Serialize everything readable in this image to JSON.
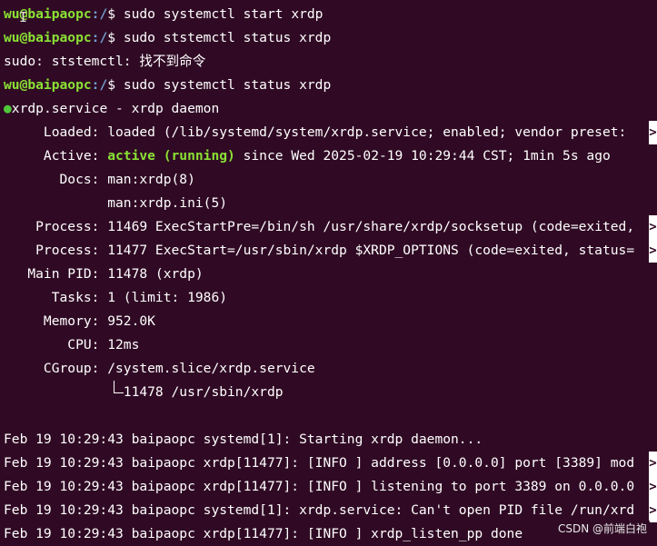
{
  "prompt": {
    "user": "wu@baipaopc",
    "path": ":/",
    "sym": "$ "
  },
  "lines": {
    "l1": "sudo systemctl start xrdp",
    "l2": "sudo ststemctl status xrdp",
    "l3": "sudo: ststemctl: 找不到命令",
    "l4": "sudo systemctl status xrdp",
    "l5": "xrdp.service - xrdp daemon",
    "l6": "     Loaded: loaded (/lib/systemd/system/xrdp.service; enabled; vendor preset: ",
    "l7a": "     Active: ",
    "l7b": "active (running)",
    "l7c": " since Wed 2025-02-19 10:29:44 CST; 1min 5s ago",
    "l8": "       Docs: man:xrdp(8)",
    "l9": "             man:xrdp.ini(5)",
    "l10": "    Process: 11469 ExecStartPre=/bin/sh /usr/share/xrdp/socksetup (code=exited,",
    "l11": "    Process: 11477 ExecStart=/usr/sbin/xrdp $XRDP_OPTIONS (code=exited, status=",
    "l12": "   Main PID: 11478 (xrdp)",
    "l13": "      Tasks: 1 (limit: 1986)",
    "l14": "     Memory: 952.0K",
    "l15": "        CPU: 12ms",
    "l16": "     CGroup: /system.slice/xrdp.service",
    "l17": "               11478 /usr/sbin/xrdp",
    "l18": "Feb 19 10:29:43 baipaopc systemd[1]: Starting xrdp daemon...",
    "l19": "Feb 19 10:29:43 baipaopc xrdp[11477]: [INFO ] address [0.0.0.0] port [3389] mod",
    "l20": "Feb 19 10:29:43 baipaopc xrdp[11477]: [INFO ] listening to port 3389 on 0.0.0.0",
    "l21": "Feb 19 10:29:43 baipaopc systemd[1]: xrdp.service: Can't open PID file /run/xrd",
    "l22": "Feb 19 10:29:43 baipaopc xrdp[11477]: [INFO ] xrdp_listen_pp done"
  },
  "trunc_marker": ">",
  "dot_glyph": "●",
  "watermark": "CSDN @前端白袍",
  "colors": {
    "background": "#300a24",
    "prompt_user": "#8ae234",
    "prompt_path": "#729fcf",
    "active": "#8ae234"
  }
}
